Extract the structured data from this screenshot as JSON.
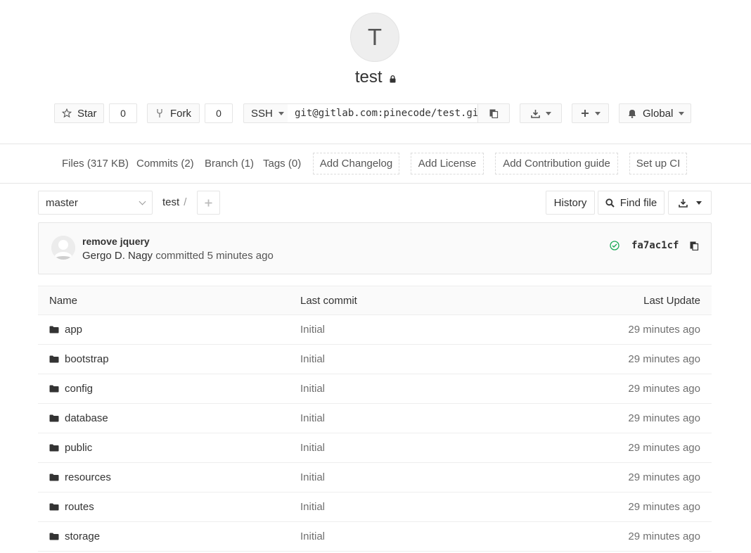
{
  "project": {
    "avatar_letter": "T",
    "name": "test"
  },
  "actions": {
    "star_label": "Star",
    "star_count": "0",
    "fork_label": "Fork",
    "fork_count": "0",
    "protocol": "SSH",
    "clone_url": "git@gitlab.com:pinecode/test.git",
    "notification_level": "Global"
  },
  "stats": {
    "files": "Files (317 KB)",
    "commits": "Commits (2)",
    "branch": "Branch (1)",
    "tags": "Tags (0)",
    "add_changelog": "Add Changelog",
    "add_license": "Add License",
    "add_contribution": "Add Contribution guide",
    "setup_ci": "Set up CI"
  },
  "tree": {
    "branch": "master",
    "path": "test",
    "path_sep": "/",
    "history": "History",
    "find_file": "Find file"
  },
  "commit": {
    "title": "remove jquery",
    "author": "Gergo D. Nagy",
    "action": "committed",
    "time": "5 minutes ago",
    "sha": "fa7ac1cf"
  },
  "table": {
    "headers": {
      "name": "Name",
      "last_commit": "Last commit",
      "last_update": "Last Update"
    },
    "rows": [
      {
        "name": "app",
        "commit": "Initial",
        "updated": "29 minutes ago"
      },
      {
        "name": "bootstrap",
        "commit": "Initial",
        "updated": "29 minutes ago"
      },
      {
        "name": "config",
        "commit": "Initial",
        "updated": "29 minutes ago"
      },
      {
        "name": "database",
        "commit": "Initial",
        "updated": "29 minutes ago"
      },
      {
        "name": "public",
        "commit": "Initial",
        "updated": "29 minutes ago"
      },
      {
        "name": "resources",
        "commit": "Initial",
        "updated": "29 minutes ago"
      },
      {
        "name": "routes",
        "commit": "Initial",
        "updated": "29 minutes ago"
      },
      {
        "name": "storage",
        "commit": "Initial",
        "updated": "29 minutes ago"
      }
    ]
  },
  "colors": {
    "success": "#1aaa55",
    "border": "#e5e5e5",
    "muted_text": "#707070"
  },
  "icons": [
    "star-icon",
    "fork-icon",
    "clipboard-icon",
    "download-icon",
    "plus-icon",
    "bell-icon",
    "search-icon",
    "lock-icon",
    "folder-icon",
    "check-circle-icon"
  ]
}
